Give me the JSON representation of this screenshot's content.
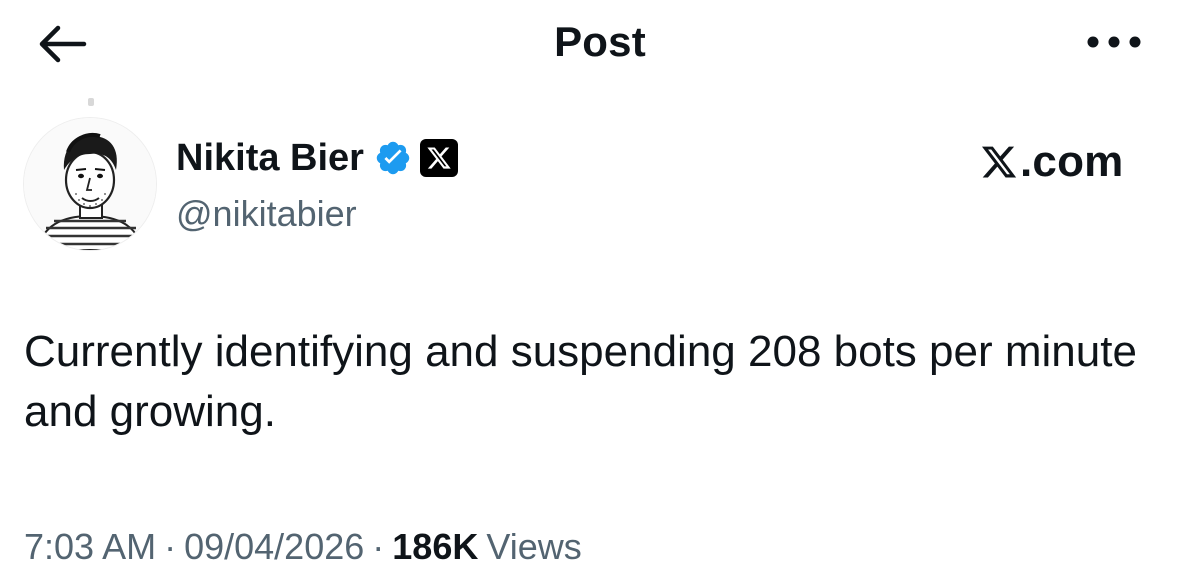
{
  "header": {
    "title": "Post",
    "back_icon": "arrow-left-icon",
    "more_icon": "more-horizontal-icon"
  },
  "author": {
    "name": "Nikita Bier",
    "handle": "@nikitabier",
    "verified_badge_color": "#1d9bf0",
    "affiliate_badge": "x-logo-icon"
  },
  "watermark": {
    "text": ".com",
    "logo": "x-logo-icon"
  },
  "post": {
    "text": "Currently identifying and suspending 208 bots per minute and growing."
  },
  "meta": {
    "time": "7:03 AM",
    "separator": "·",
    "date": "09/04/2026",
    "views_count": "186K",
    "views_label": "Views"
  },
  "colors": {
    "text_primary": "#0f1419",
    "text_secondary": "#536471",
    "accent": "#1d9bf0",
    "background": "#ffffff"
  }
}
